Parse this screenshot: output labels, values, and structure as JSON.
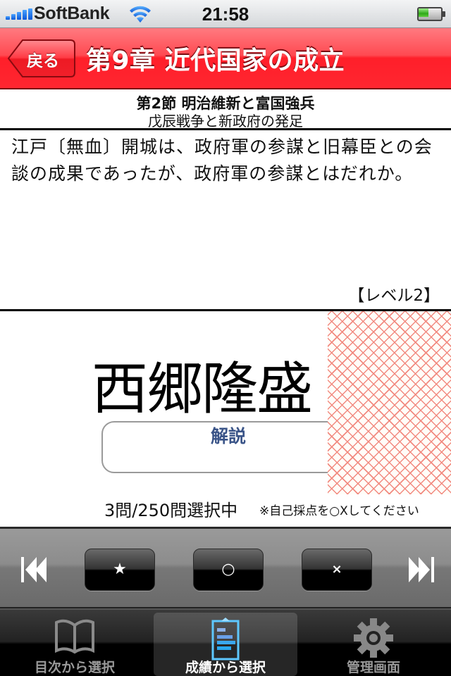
{
  "status_bar": {
    "carrier": "SoftBank",
    "time": "21:58",
    "signal_bars": 5,
    "wifi": "wifi-icon",
    "battery_level": 0.5
  },
  "nav": {
    "back_label": "戻る",
    "title": "第9章 近代国家の成立",
    "color": "#ff2630"
  },
  "section": {
    "heading": "第2節 明治維新と富国強兵",
    "subheading": "戊辰戦争と新政府の発足"
  },
  "question": {
    "text": "江戸〔無血〕開城は、政府軍の参謀と旧幕臣との会談の成果であったが、政府軍の参謀とはだれか。",
    "level": "【レベル2】"
  },
  "answer": {
    "text": "西郷隆盛",
    "explain_label": "解説",
    "mask_color": "#f28a80"
  },
  "progress": {
    "text": "3問/250問選択中",
    "hint": "※自己採点を○Xしてください"
  },
  "toolbar": {
    "first_icon": "skip-back-icon",
    "star_label": "★",
    "correct_label": "○",
    "wrong_label": "×",
    "last_icon": "skip-forward-icon"
  },
  "tabs": [
    {
      "label": "目次から選択",
      "icon": "book-icon",
      "active": false
    },
    {
      "label": "成績から選択",
      "icon": "clipboard-chart-icon",
      "active": true
    },
    {
      "label": "管理画面",
      "icon": "gear-icon",
      "active": false
    }
  ]
}
